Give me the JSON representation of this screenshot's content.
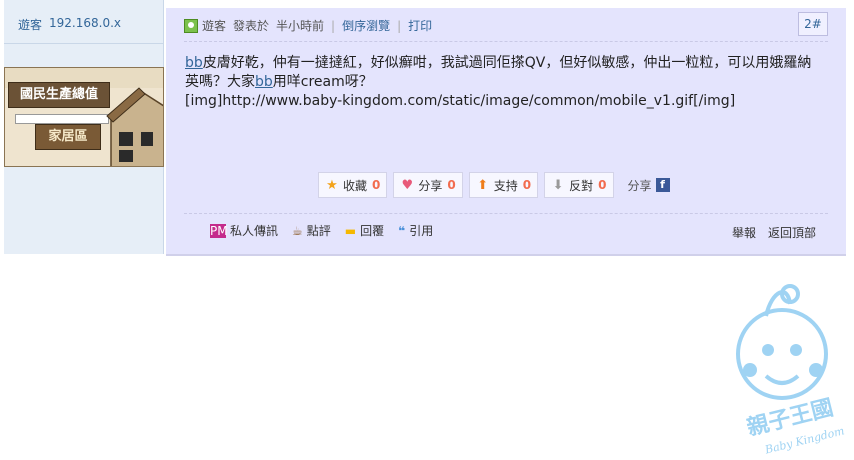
{
  "user": {
    "name": "遊客",
    "ip": "192.168.0.x"
  },
  "banner": {
    "title": "國民生產總值",
    "subtitle": "家居區"
  },
  "post": {
    "meta": {
      "author": "遊客",
      "posted": "發表於",
      "time": "半小時前",
      "reverse": "倒序瀏覽",
      "print": "打印"
    },
    "floor": "2#",
    "content": {
      "hl1": "bb",
      "text1": "皮膚好乾，仲有一撻撻紅，好似癬咁，我試過同佢搽QV，但好似敏感，仲出一粒粒，可以用娥羅納英嗎？大家",
      "hl2": "bb",
      "text2": "用咩cream呀？",
      "line2": "[img]http://www.baby-kingdom.com/static/image/common/mobile_v1.gif[/img]"
    },
    "actions": [
      {
        "label": "收藏",
        "count": "0",
        "icon": "star-icon"
      },
      {
        "label": "分享",
        "count": "0",
        "icon": "heart-icon"
      },
      {
        "label": "支持",
        "count": "0",
        "icon": "arrow-up-icon"
      },
      {
        "label": "反對",
        "count": "0",
        "icon": "arrow-down-icon"
      }
    ],
    "share_label": "分享",
    "footer": {
      "pm": "私人傳訊",
      "rate": "點評",
      "reply": "回覆",
      "quote": "引用",
      "report": "舉報",
      "top": "返回頂部"
    }
  },
  "watermark": {
    "name": "親子王國",
    "en": "Baby Kingdom"
  },
  "colors": {
    "panel": "#e4e4fd",
    "link": "#336699",
    "count": "#f26c4f"
  }
}
